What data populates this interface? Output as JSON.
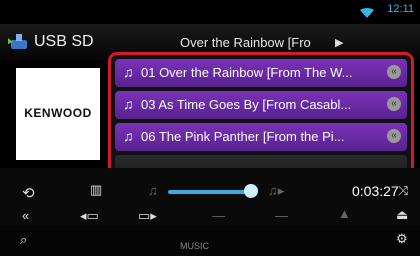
{
  "status": {
    "clock": "12:11",
    "wifi_icon": "wifi-icon"
  },
  "header": {
    "source_label": "USB SD",
    "now_playing": "Over the Rainbow [Fro"
  },
  "cover": {
    "brand_text": "KENWOOD"
  },
  "playlist": {
    "items": [
      {
        "label": "01 Over the Rainbow [From The W...",
        "selected": true
      },
      {
        "label": "03 As Time Goes By [From Casabl...",
        "selected": true
      },
      {
        "label": "06 The Pink Panther [From the Pi...",
        "selected": true
      },
      {
        "label": "",
        "selected": false
      }
    ]
  },
  "transport": {
    "time": "0:03:27",
    "progress": 0.55
  },
  "bottom": {
    "label": "MUSIC"
  }
}
